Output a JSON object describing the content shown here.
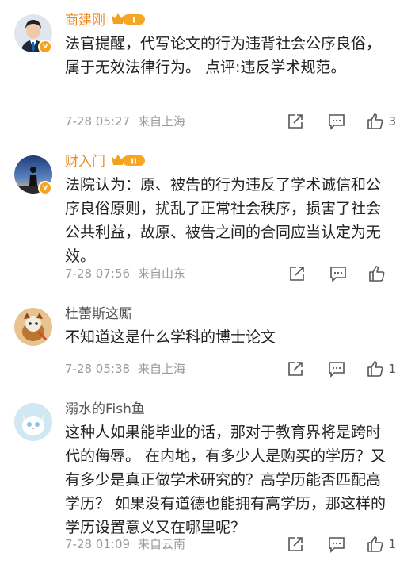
{
  "comments": [
    {
      "name": "商建刚",
      "vip": true,
      "level": "I",
      "text": "法官提醒，代写论文的行为违背社会公序良俗，属于无效法律行为。 点评:违反学术规范。",
      "date": "7-28 05:27",
      "location": "来自上海",
      "likes": "3",
      "avatar_icon": "person-in-suit"
    },
    {
      "name": "财入门",
      "vip": true,
      "level": "II",
      "text": "法院认为：原、被告的行为违反了学术诚信和公序良俗原则，扰乱了正常社会秩序，损害了社会公共利益，故原、被告之间的合同应当认定为无效。",
      "date": "7-28 07:56",
      "location": "来自山东",
      "likes": "",
      "avatar_icon": "sunset-silhouette"
    },
    {
      "name": "杜蕾斯这厮",
      "vip": false,
      "level": "",
      "text": "不知道这是什么学科的博士论文",
      "date": "7-28 05:38",
      "location": "来自上海",
      "likes": "1",
      "avatar_icon": "cartoon-animal"
    },
    {
      "name": "溺水的Fish鱼",
      "vip": false,
      "level": "",
      "text": "这种人如果能毕业的话，那对于教育界将是跨时代的侮辱。 在内地，有多少人是购买的学历？又有多少是真正做学术研究的？高学历能否匹配高学历？ 如果没有道德也能拥有高学历，那这样的学历设置意义又在哪里呢？",
      "date": "7-28 01:09",
      "location": "来自云南",
      "likes": "1",
      "avatar_icon": "white-kitten"
    }
  ]
}
